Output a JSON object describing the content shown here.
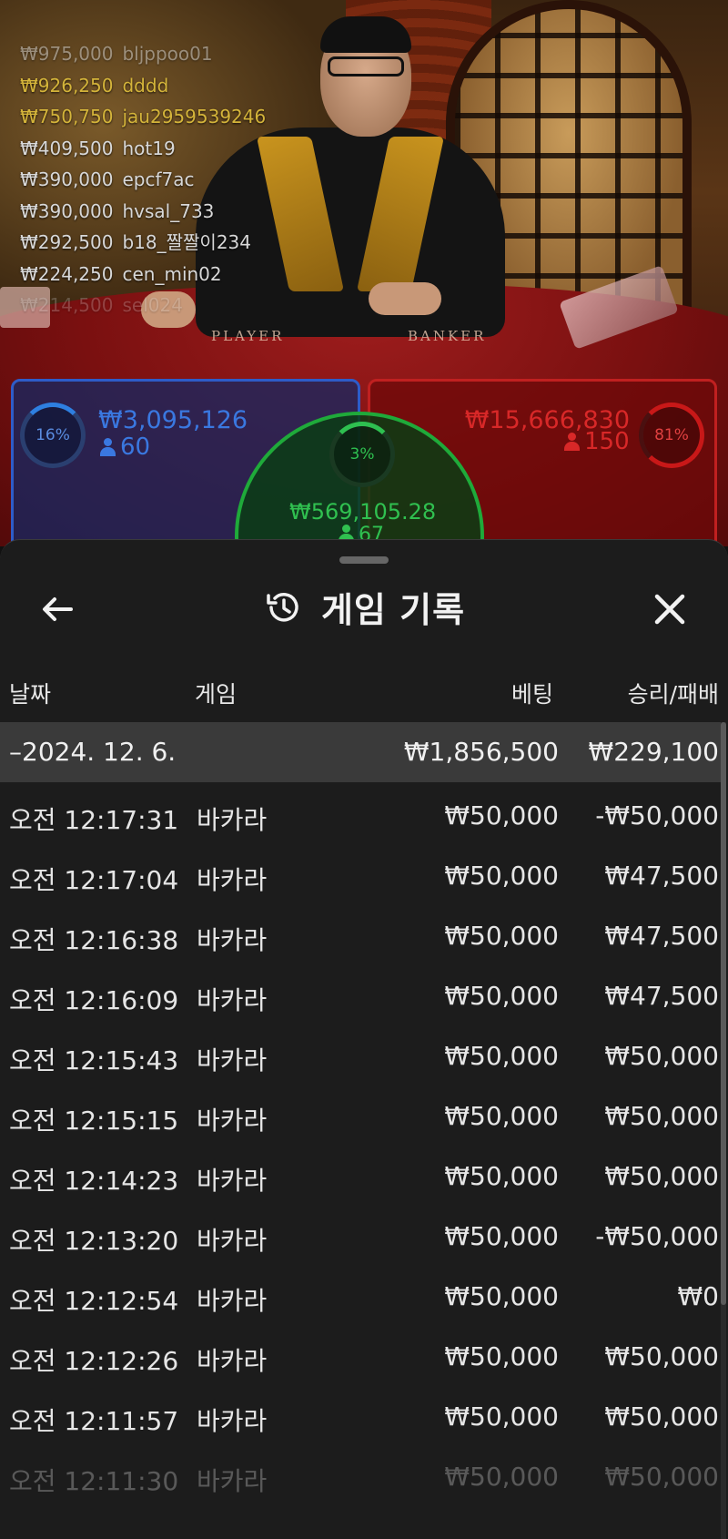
{
  "leaderboard": [
    {
      "amount": "₩975,000",
      "user": "bljppoo01",
      "style": "white fade1"
    },
    {
      "amount": "₩926,250",
      "user": "dddd",
      "style": "gold"
    },
    {
      "amount": "₩750,750",
      "user": "jau2959539246",
      "style": "gold"
    },
    {
      "amount": "₩409,500",
      "user": "hot19",
      "style": "white"
    },
    {
      "amount": "₩390,000",
      "user": "epcf7ac",
      "style": "white"
    },
    {
      "amount": "₩390,000",
      "user": "hvsal_733",
      "style": "white"
    },
    {
      "amount": "₩292,500",
      "user": "b18_짤짤이234",
      "style": "white"
    },
    {
      "amount": "₩224,250",
      "user": "cen_min02",
      "style": "white"
    },
    {
      "amount": "₩214,500",
      "user": "sel024",
      "style": "white fade2"
    }
  ],
  "table_labels": {
    "player": "PLAYER",
    "banker": "BANKER"
  },
  "bets": {
    "player": {
      "percent": "16%",
      "amount": "₩3,095,126",
      "count": "60"
    },
    "banker": {
      "percent": "81%",
      "amount": "₩15,666,830",
      "count": "150"
    },
    "tie": {
      "percent": "3%",
      "amount": "₩569,105.28",
      "count": "67"
    }
  },
  "sheet": {
    "title": "게임 기록",
    "columns": {
      "date": "날짜",
      "game": "게임",
      "bet": "베팅",
      "win_loss": "승리/패배"
    },
    "summary": {
      "date": "–2024. 12. 6.",
      "bet": "₩1,856,500",
      "win_loss": "₩229,100"
    },
    "rows": [
      {
        "time": "오전 12:17:31",
        "game": "바카라",
        "bet": "₩50,000",
        "result": "-₩50,000"
      },
      {
        "time": "오전 12:17:04",
        "game": "바카라",
        "bet": "₩50,000",
        "result": "₩47,500"
      },
      {
        "time": "오전 12:16:38",
        "game": "바카라",
        "bet": "₩50,000",
        "result": "₩47,500"
      },
      {
        "time": "오전 12:16:09",
        "game": "바카라",
        "bet": "₩50,000",
        "result": "₩47,500"
      },
      {
        "time": "오전 12:15:43",
        "game": "바카라",
        "bet": "₩50,000",
        "result": "₩50,000"
      },
      {
        "time": "오전 12:15:15",
        "game": "바카라",
        "bet": "₩50,000",
        "result": "₩50,000"
      },
      {
        "time": "오전 12:14:23",
        "game": "바카라",
        "bet": "₩50,000",
        "result": "₩50,000"
      },
      {
        "time": "오전 12:13:20",
        "game": "바카라",
        "bet": "₩50,000",
        "result": "-₩50,000"
      },
      {
        "time": "오전 12:12:54",
        "game": "바카라",
        "bet": "₩50,000",
        "result": "₩0"
      },
      {
        "time": "오전 12:12:26",
        "game": "바카라",
        "bet": "₩50,000",
        "result": "₩50,000"
      },
      {
        "time": "오전 12:11:57",
        "game": "바카라",
        "bet": "₩50,000",
        "result": "₩50,000"
      },
      {
        "time": "오전 12:11:30",
        "game": "바카라",
        "bet": "₩50,000",
        "result": "₩50,000"
      }
    ]
  },
  "icons": {
    "back": "arrow-left-icon",
    "history": "history-icon",
    "close": "close-icon",
    "person": "person-icon"
  },
  "colors": {
    "player": "#2e5cc8",
    "banker": "#c02020",
    "tie": "#1faa3a",
    "gold_text": "#d4b43a",
    "sheet_bg": "#1c1c1c",
    "summary_bg": "#3a3a3a"
  }
}
